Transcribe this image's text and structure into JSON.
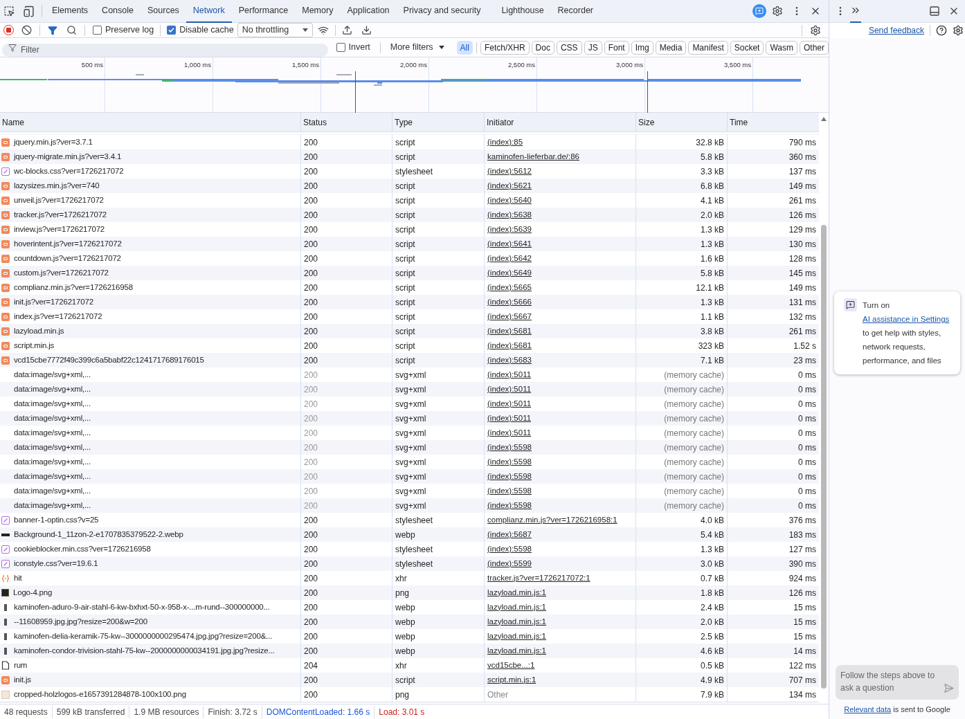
{
  "tabs": [
    {
      "label": "Elements",
      "selected": false
    },
    {
      "label": "Console",
      "selected": false
    },
    {
      "label": "Sources",
      "selected": false
    },
    {
      "label": "Network",
      "selected": true
    },
    {
      "label": "Performance",
      "selected": false
    },
    {
      "label": "Memory",
      "selected": false
    },
    {
      "label": "Application",
      "selected": false
    },
    {
      "label": "Privacy and security",
      "selected": false
    },
    {
      "label": "Lighthouse",
      "selected": false
    },
    {
      "label": "Recorder",
      "selected": false
    }
  ],
  "toolbar": {
    "preserve_log": {
      "label": "Preserve log",
      "checked": false
    },
    "disable_cache": {
      "label": "Disable cache",
      "checked": true
    },
    "throttling": "No throttling"
  },
  "filter": {
    "placeholder": "Filter",
    "invert": {
      "label": "Invert",
      "checked": false
    },
    "more_filters": "More filters"
  },
  "type_filters": [
    {
      "label": "All",
      "selected": true
    },
    {
      "label": "Fetch/XHR",
      "selected": false
    },
    {
      "label": "Doc",
      "selected": false
    },
    {
      "label": "CSS",
      "selected": false
    },
    {
      "label": "JS",
      "selected": false
    },
    {
      "label": "Font",
      "selected": false
    },
    {
      "label": "Img",
      "selected": false
    },
    {
      "label": "Media",
      "selected": false
    },
    {
      "label": "Manifest",
      "selected": false
    },
    {
      "label": "Socket",
      "selected": false
    },
    {
      "label": "Wasm",
      "selected": false
    },
    {
      "label": "Other",
      "selected": false
    }
  ],
  "timeline": {
    "ticks": [
      "500 ms",
      "1,000 ms",
      "1,500 ms",
      "2,000 ms",
      "2,500 ms",
      "3,000 ms",
      "3,500 ms"
    ]
  },
  "table": {
    "columns": [
      "Name",
      "Status",
      "Type",
      "Initiator",
      "Size",
      "Time"
    ],
    "rows": [
      {
        "kind": "script",
        "name": "jquery.min.js?ver=3.7.1",
        "status": "200",
        "type": "script",
        "initiator": "(index):85",
        "initiator_link": true,
        "size": "32.8 kB",
        "time": "790 ms",
        "cached": false
      },
      {
        "kind": "script",
        "name": "jquery-migrate.min.js?ver=3.4.1",
        "status": "200",
        "type": "script",
        "initiator": "kaminofen-lieferbar.de/:86",
        "initiator_link": true,
        "size": "5.8 kB",
        "time": "360 ms",
        "cached": false
      },
      {
        "kind": "stylesheet",
        "name": "wc-blocks.css?ver=1726217072",
        "status": "200",
        "type": "stylesheet",
        "initiator": "(index):5612",
        "initiator_link": true,
        "size": "3.3 kB",
        "time": "137 ms",
        "cached": false
      },
      {
        "kind": "script",
        "name": "lazysizes.min.js?ver=740",
        "status": "200",
        "type": "script",
        "initiator": "(index):5621",
        "initiator_link": true,
        "size": "6.8 kB",
        "time": "149 ms",
        "cached": false
      },
      {
        "kind": "script",
        "name": "unveil.js?ver=1726217072",
        "status": "200",
        "type": "script",
        "initiator": "(index):5640",
        "initiator_link": true,
        "size": "4.1 kB",
        "time": "261 ms",
        "cached": false
      },
      {
        "kind": "script",
        "name": "tracker.js?ver=1726217072",
        "status": "200",
        "type": "script",
        "initiator": "(index):5638",
        "initiator_link": true,
        "size": "2.0 kB",
        "time": "126 ms",
        "cached": false
      },
      {
        "kind": "script",
        "name": "inview.js?ver=1726217072",
        "status": "200",
        "type": "script",
        "initiator": "(index):5639",
        "initiator_link": true,
        "size": "1.3 kB",
        "time": "129 ms",
        "cached": false
      },
      {
        "kind": "script",
        "name": "hoverintent.js?ver=1726217072",
        "status": "200",
        "type": "script",
        "initiator": "(index):5641",
        "initiator_link": true,
        "size": "1.3 kB",
        "time": "130 ms",
        "cached": false
      },
      {
        "kind": "script",
        "name": "countdown.js?ver=1726217072",
        "status": "200",
        "type": "script",
        "initiator": "(index):5642",
        "initiator_link": true,
        "size": "1.6 kB",
        "time": "128 ms",
        "cached": false
      },
      {
        "kind": "script",
        "name": "custom.js?ver=1726217072",
        "status": "200",
        "type": "script",
        "initiator": "(index):5649",
        "initiator_link": true,
        "size": "5.8 kB",
        "time": "145 ms",
        "cached": false
      },
      {
        "kind": "script",
        "name": "complianz.min.js?ver=1726216958",
        "status": "200",
        "type": "script",
        "initiator": "(index):5665",
        "initiator_link": true,
        "size": "12.1 kB",
        "time": "149 ms",
        "cached": false
      },
      {
        "kind": "script",
        "name": "init.js?ver=1726217072",
        "status": "200",
        "type": "script",
        "initiator": "(index):5666",
        "initiator_link": true,
        "size": "1.3 kB",
        "time": "131 ms",
        "cached": false
      },
      {
        "kind": "script",
        "name": "index.js?ver=1726217072",
        "status": "200",
        "type": "script",
        "initiator": "(index):5667",
        "initiator_link": true,
        "size": "1.1 kB",
        "time": "132 ms",
        "cached": false
      },
      {
        "kind": "script",
        "name": "lazyload.min.js",
        "status": "200",
        "type": "script",
        "initiator": "(index):5681",
        "initiator_link": true,
        "size": "3.8 kB",
        "time": "261 ms",
        "cached": false
      },
      {
        "kind": "script",
        "name": "script.min.js",
        "status": "200",
        "type": "script",
        "initiator": "(index):5681",
        "initiator_link": true,
        "size": "323 kB",
        "time": "1.52 s",
        "cached": false
      },
      {
        "kind": "script",
        "name": "vcd15cbe7772f49c399c6a5babf22c1241717689176015",
        "status": "200",
        "type": "script",
        "initiator": "(index):5683",
        "initiator_link": true,
        "size": "7.1 kB",
        "time": "23 ms",
        "cached": false
      },
      {
        "kind": "inline",
        "name": "data:image/svg+xml,...",
        "status": "200",
        "type": "svg+xml",
        "initiator": "(index):5011",
        "initiator_link": true,
        "size": "(memory cache)",
        "time": "0 ms",
        "cached": true
      },
      {
        "kind": "inline",
        "name": "data:image/svg+xml,...",
        "status": "200",
        "type": "svg+xml",
        "initiator": "(index):5011",
        "initiator_link": true,
        "size": "(memory cache)",
        "time": "0 ms",
        "cached": true
      },
      {
        "kind": "inline",
        "name": "data:image/svg+xml,...",
        "status": "200",
        "type": "svg+xml",
        "initiator": "(index):5011",
        "initiator_link": true,
        "size": "(memory cache)",
        "time": "0 ms",
        "cached": true
      },
      {
        "kind": "inline",
        "name": "data:image/svg+xml,...",
        "status": "200",
        "type": "svg+xml",
        "initiator": "(index):5011",
        "initiator_link": true,
        "size": "(memory cache)",
        "time": "0 ms",
        "cached": true
      },
      {
        "kind": "inline",
        "name": "data:image/svg+xml,...",
        "status": "200",
        "type": "svg+xml",
        "initiator": "(index):5011",
        "initiator_link": true,
        "size": "(memory cache)",
        "time": "0 ms",
        "cached": true
      },
      {
        "kind": "inline",
        "name": "data:image/svg+xml,...",
        "status": "200",
        "type": "svg+xml",
        "initiator": "(index):5598",
        "initiator_link": true,
        "size": "(memory cache)",
        "time": "0 ms",
        "cached": true
      },
      {
        "kind": "inline",
        "name": "data:image/svg+xml,...",
        "status": "200",
        "type": "svg+xml",
        "initiator": "(index):5598",
        "initiator_link": true,
        "size": "(memory cache)",
        "time": "0 ms",
        "cached": true
      },
      {
        "kind": "inline",
        "name": "data:image/svg+xml,...",
        "status": "200",
        "type": "svg+xml",
        "initiator": "(index):5598",
        "initiator_link": true,
        "size": "(memory cache)",
        "time": "0 ms",
        "cached": true
      },
      {
        "kind": "inline",
        "name": "data:image/svg+xml,...",
        "status": "200",
        "type": "svg+xml",
        "initiator": "(index):5598",
        "initiator_link": true,
        "size": "(memory cache)",
        "time": "0 ms",
        "cached": true
      },
      {
        "kind": "inline",
        "name": "data:image/svg+xml,...",
        "status": "200",
        "type": "svg+xml",
        "initiator": "(index):5598",
        "initiator_link": true,
        "size": "(memory cache)",
        "time": "0 ms",
        "cached": true
      },
      {
        "kind": "stylesheet",
        "name": "banner-1-optin.css?v=25",
        "status": "200",
        "type": "stylesheet",
        "initiator": "complianz.min.js?ver=1726216958:1",
        "initiator_link": true,
        "size": "4.0 kB",
        "time": "376 ms",
        "cached": false
      },
      {
        "kind": "banner",
        "name": "Background-1_11zon-2-e1707835379522-2.webp",
        "status": "200",
        "type": "webp",
        "initiator": "(index):5687",
        "initiator_link": true,
        "size": "5.4 kB",
        "time": "183 ms",
        "cached": false
      },
      {
        "kind": "stylesheet",
        "name": "cookieblocker.min.css?ver=1726216958",
        "status": "200",
        "type": "stylesheet",
        "initiator": "(index):5598",
        "initiator_link": true,
        "size": "1.3 kB",
        "time": "127 ms",
        "cached": false
      },
      {
        "kind": "stylesheet",
        "name": "iconstyle.css?ver=19.6.1",
        "status": "200",
        "type": "stylesheet",
        "initiator": "(index):5599",
        "initiator_link": true,
        "size": "3.0 kB",
        "time": "390 ms",
        "cached": false
      },
      {
        "kind": "fetch",
        "name": "hit",
        "status": "200",
        "type": "xhr",
        "initiator": "tracker.js?ver=1726217072:1",
        "initiator_link": true,
        "size": "0.7 kB",
        "time": "924 ms",
        "cached": false
      },
      {
        "kind": "logo",
        "name": "Logo-4.png",
        "status": "200",
        "type": "png",
        "initiator": "lazyload.min.js:1",
        "initiator_link": true,
        "size": "1.8 kB",
        "time": "126 ms",
        "cached": false
      },
      {
        "kind": "thumbnail",
        "name": "kaminofen-aduro-9-air-stahl-6-kw-bxhxt-50-x-958-x-...m-rund--300000000...",
        "status": "200",
        "type": "webp",
        "initiator": "lazyload.min.js:1",
        "initiator_link": true,
        "size": "2.4 kB",
        "time": "15 ms",
        "cached": false
      },
      {
        "kind": "thumbnail",
        "name": "--11608959.jpg.jpg?resize=200&w=200",
        "status": "200",
        "type": "webp",
        "initiator": "lazyload.min.js:1",
        "initiator_link": true,
        "size": "2.0 kB",
        "time": "15 ms",
        "cached": false
      },
      {
        "kind": "thumbnail",
        "name": "kaminofen-delia-keramik-75-kw--3000000000295474.jpg.jpg?resize=200&...",
        "status": "200",
        "type": "webp",
        "initiator": "lazyload.min.js:1",
        "initiator_link": true,
        "size": "2.5 kB",
        "time": "15 ms",
        "cached": false
      },
      {
        "kind": "thumbnail",
        "name": "kaminofen-condor-trivision-stahl-75-kw--2000000000034191.jpg.jpg?resize...",
        "status": "200",
        "type": "webp",
        "initiator": "lazyload.min.js:1",
        "initiator_link": true,
        "size": "4.6 kB",
        "time": "14 ms",
        "cached": false
      },
      {
        "kind": "document",
        "name": "rum",
        "status": "204",
        "type": "xhr",
        "initiator": "vcd15cbe...:1",
        "initiator_link": true,
        "size": "0.5 kB",
        "time": "122 ms",
        "cached": false
      },
      {
        "kind": "script",
        "name": "init.js",
        "status": "200",
        "type": "script",
        "initiator": "script.min.js:1",
        "initiator_link": true,
        "size": "4.9 kB",
        "time": "707 ms",
        "cached": false
      },
      {
        "kind": "image",
        "name": "cropped-holzlogos-e1657391284878-100x100.png",
        "status": "200",
        "type": "png",
        "initiator": "Other",
        "initiator_link": false,
        "size": "7.9 kB",
        "time": "134 ms",
        "cached": false
      }
    ]
  },
  "status_bar": [
    {
      "text": "48 requests",
      "color": "#474747"
    },
    {
      "text": "599 kB transferred",
      "color": "#474747"
    },
    {
      "text": "1.9 MB resources",
      "color": "#474747"
    },
    {
      "text": "Finish: 3.72 s",
      "color": "#474747"
    },
    {
      "text": "DOMContentLoaded: 1.66 s",
      "color": "#1a56d6"
    },
    {
      "text": "Load: 3.01 s",
      "color": "#c5221f"
    }
  ],
  "side_panel": {
    "send_feedback": "Send feedback",
    "notice": {
      "before": "Turn on ",
      "link": "AI assistance in Settings",
      "after": " to get help with styles, network requests, performance, and files"
    },
    "input_placeholder": "Follow the steps above to ask a question",
    "footer": {
      "link": "Relevant data",
      "after": " is sent to Google"
    }
  }
}
